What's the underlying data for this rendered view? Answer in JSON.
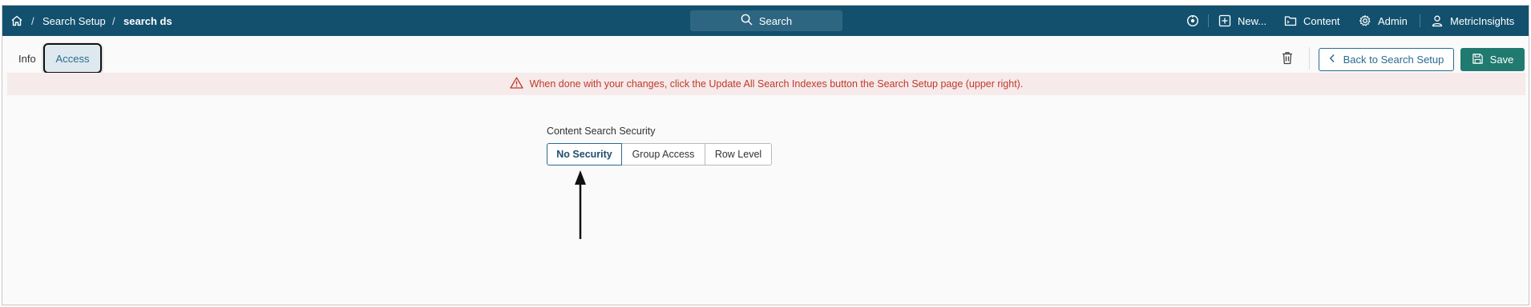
{
  "topbar": {
    "breadcrumb": [
      {
        "label": "Search Setup"
      },
      {
        "label": "search ds"
      }
    ],
    "separator": "/",
    "search_label": "Search",
    "new_label": "New...",
    "content_label": "Content",
    "admin_label": "Admin",
    "user_label": "MetricInsights",
    "background_color": "#12506e"
  },
  "tabs": [
    {
      "label": "Info",
      "active": false
    },
    {
      "label": "Access",
      "active": true
    }
  ],
  "toolbar": {
    "back_label": "Back to Search Setup",
    "save_label": "Save"
  },
  "warning": {
    "text": "When done with your changes, click the Update All Search Indexes button the Search Setup page (upper right)."
  },
  "content_security": {
    "label": "Content Search Security",
    "options": [
      {
        "label": "No Security",
        "selected": true
      },
      {
        "label": "Group Access",
        "selected": false
      },
      {
        "label": "Row Level",
        "selected": false
      }
    ]
  },
  "colors": {
    "accent": "#2a6b8e",
    "save": "#207a6f",
    "warning_text": "#c0392b",
    "warning_bg": "#f6eaea"
  },
  "icons": {
    "home": "home-icon",
    "search": "search-icon",
    "spinner": "spinner-icon",
    "new": "plus-square-icon",
    "content": "folder-icon",
    "admin": "gear-icon",
    "user": "user-icon",
    "trash": "trash-icon",
    "back": "chevron-left-icon",
    "save": "floppy-disk-icon",
    "warning": "warning-triangle-icon",
    "arrow": "up-arrow-annotation-icon"
  }
}
